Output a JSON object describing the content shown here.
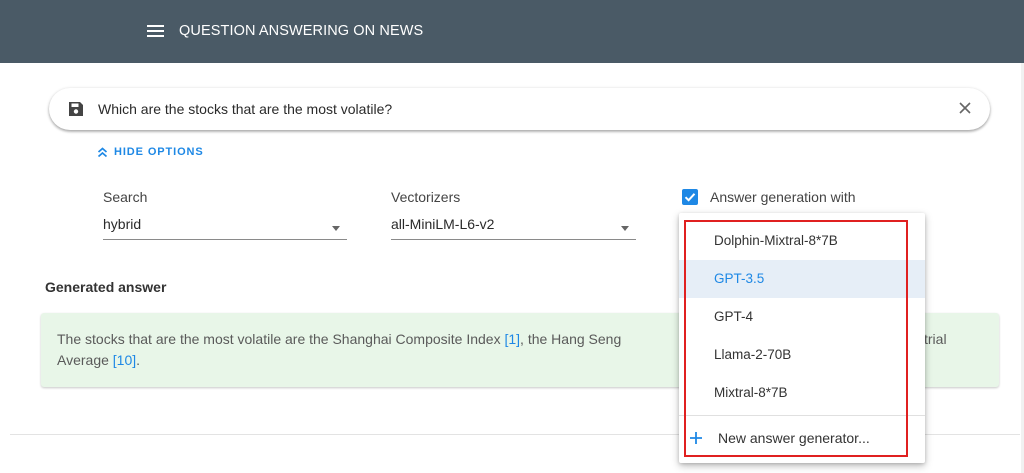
{
  "app": {
    "title": "QUESTION ANSWERING ON NEWS"
  },
  "search": {
    "query": "Which are the stocks that are the most volatile?"
  },
  "options": {
    "toggle_label": "HIDE OPTIONS",
    "search_label": "Search",
    "search_value": "hybrid",
    "vectorizers_label": "Vectorizers",
    "vectorizers_value": "all-MiniLM-L6-v2",
    "answer_generation_label": "Answer generation with",
    "answer_generation_checked": true
  },
  "answer": {
    "title": "Generated answer",
    "line1_text": "The stocks that are the most volatile are the Shanghai Composite Index ",
    "ref1": "[1]",
    "line1_tail": ", the Hang Seng",
    "line1_end": "strial",
    "line2_text": "Average ",
    "ref2": "[10]",
    "line2_tail": "."
  },
  "generator_menu": {
    "items": [
      {
        "label": "Dolphin-Mixtral-8*7B",
        "selected": false
      },
      {
        "label": "GPT-3.5",
        "selected": true
      },
      {
        "label": "GPT-4",
        "selected": false
      },
      {
        "label": "Llama-2-70B",
        "selected": false
      },
      {
        "label": "Mixtral-8*7B",
        "selected": false
      }
    ],
    "new_item_label": "New answer generator..."
  },
  "colors": {
    "appbar": "#4a5a66",
    "accent": "#1e88e5",
    "answer_bg": "#e8f6e8",
    "highlight": "#e02020"
  }
}
